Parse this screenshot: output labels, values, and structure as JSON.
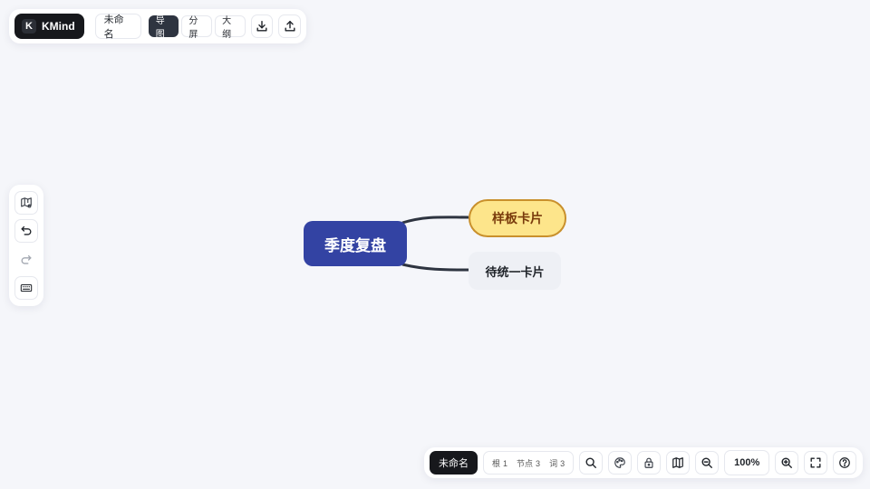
{
  "app": {
    "logo_letter": "K",
    "name": "KMind"
  },
  "top_toolbar": {
    "document_title": "未命名",
    "view_modes": [
      {
        "label": "导图",
        "active": true
      },
      {
        "label": "分屏",
        "active": false
      },
      {
        "label": "大纲",
        "active": false
      }
    ],
    "icons": [
      "download-icon",
      "upload-icon"
    ]
  },
  "left_toolbar": {
    "icons": [
      "map-settings-icon",
      "undo-icon",
      "redo-icon",
      "keyboard-icon"
    ]
  },
  "mindmap": {
    "root": {
      "label": "季度复盘",
      "color": "#3343a3"
    },
    "children": [
      {
        "label": "样板卡片",
        "fill": "#fde58b",
        "border": "#c9902c"
      },
      {
        "label": "待统一卡片",
        "fill": "#eef0f5"
      }
    ],
    "connector_color": "#2e3440"
  },
  "bottom_toolbar": {
    "document_title": "未命名",
    "stats": [
      {
        "label": "根",
        "value": "1"
      },
      {
        "label": "节点",
        "value": "3"
      },
      {
        "label": "词",
        "value": "3"
      }
    ],
    "zoom": "100%",
    "icons": [
      "search-icon",
      "theme-palette-icon",
      "lock-icon",
      "minimap-icon",
      "zoom-out-icon",
      "zoom-in-icon",
      "fullscreen-icon",
      "help-icon"
    ]
  }
}
